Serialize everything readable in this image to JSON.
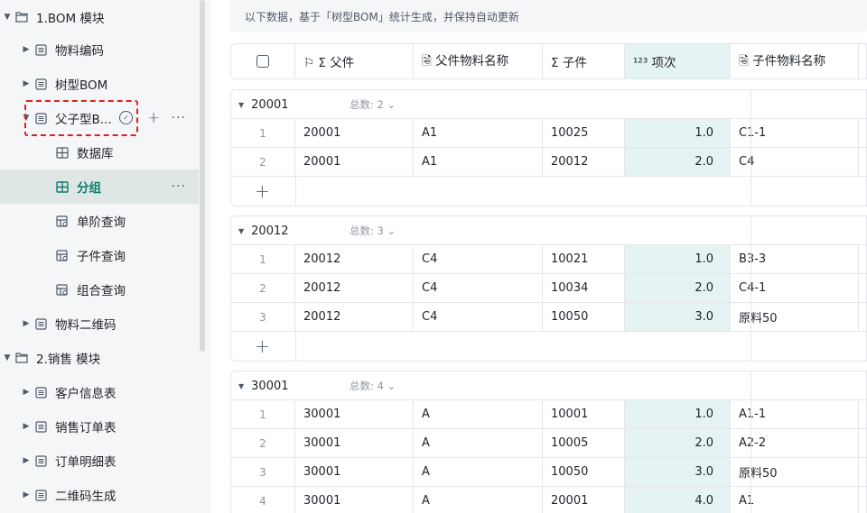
{
  "sidebar": {
    "items": [
      {
        "label": "1.BOM 模块",
        "type": "folder",
        "expanded": true
      },
      {
        "label": "物料编码",
        "type": "table"
      },
      {
        "label": "树型BOM",
        "type": "table"
      },
      {
        "label": "父子型B...",
        "type": "table",
        "expanded": true
      },
      {
        "label": "数据库",
        "type": "grid-view"
      },
      {
        "label": "分组",
        "type": "grid-view",
        "selected": true
      },
      {
        "label": "单阶查询",
        "type": "form-view"
      },
      {
        "label": "子件查询",
        "type": "form-view"
      },
      {
        "label": "组合查询",
        "type": "form-view"
      },
      {
        "label": "物料二维码",
        "type": "table"
      },
      {
        "label": "2.销售 模块",
        "type": "folder",
        "expanded": true
      },
      {
        "label": "客户信息表",
        "type": "table"
      },
      {
        "label": "销售订单表",
        "type": "table"
      },
      {
        "label": "订单明细表",
        "type": "table"
      },
      {
        "label": "二维码生成",
        "type": "table"
      }
    ],
    "more_glyph": "···",
    "add_glyph": "+"
  },
  "notice": "以下数据，基于「树型BOM」统计生成，并保持自动更新",
  "table": {
    "columns": [
      "⚐ Σ 父件",
      "🗟 父件物料名称",
      "Σ 子件",
      "¹²³ 项次",
      "🗟 子件物料名称"
    ],
    "groups": [
      {
        "name": "20001",
        "count_label": "总数: 2 ⌄",
        "rows": [
          {
            "idx": "1",
            "parent": "20001",
            "parent_name": "A1",
            "child": "10025",
            "seq": "1.0",
            "child_name": "C1-1"
          },
          {
            "idx": "2",
            "parent": "20001",
            "parent_name": "A1",
            "child": "20012",
            "seq": "2.0",
            "child_name": "C4"
          }
        ]
      },
      {
        "name": "20012",
        "count_label": "总数: 3 ⌄",
        "rows": [
          {
            "idx": "1",
            "parent": "20012",
            "parent_name": "C4",
            "child": "10021",
            "seq": "1.0",
            "child_name": "B3-3"
          },
          {
            "idx": "2",
            "parent": "20012",
            "parent_name": "C4",
            "child": "10034",
            "seq": "2.0",
            "child_name": "C4-1"
          },
          {
            "idx": "3",
            "parent": "20012",
            "parent_name": "C4",
            "child": "10050",
            "seq": "3.0",
            "child_name": "原料50"
          }
        ]
      },
      {
        "name": "30001",
        "count_label": "总数: 4 ⌄",
        "rows": [
          {
            "idx": "1",
            "parent": "30001",
            "parent_name": "A",
            "child": "10001",
            "seq": "1.0",
            "child_name": "A1-1"
          },
          {
            "idx": "2",
            "parent": "30001",
            "parent_name": "A",
            "child": "10005",
            "seq": "2.0",
            "child_name": "A2-2"
          },
          {
            "idx": "3",
            "parent": "30001",
            "parent_name": "A",
            "child": "10050",
            "seq": "3.0",
            "child_name": "原料50"
          },
          {
            "idx": "4",
            "parent": "30001",
            "parent_name": "A",
            "child": "20001",
            "seq": "4.0",
            "child_name": "A1"
          }
        ]
      }
    ],
    "add_glyph": "+"
  },
  "colors": {
    "accent": "#0d7a6b",
    "highlight_column": "#e5f3f2",
    "dashed_annotation": "#e02020"
  }
}
